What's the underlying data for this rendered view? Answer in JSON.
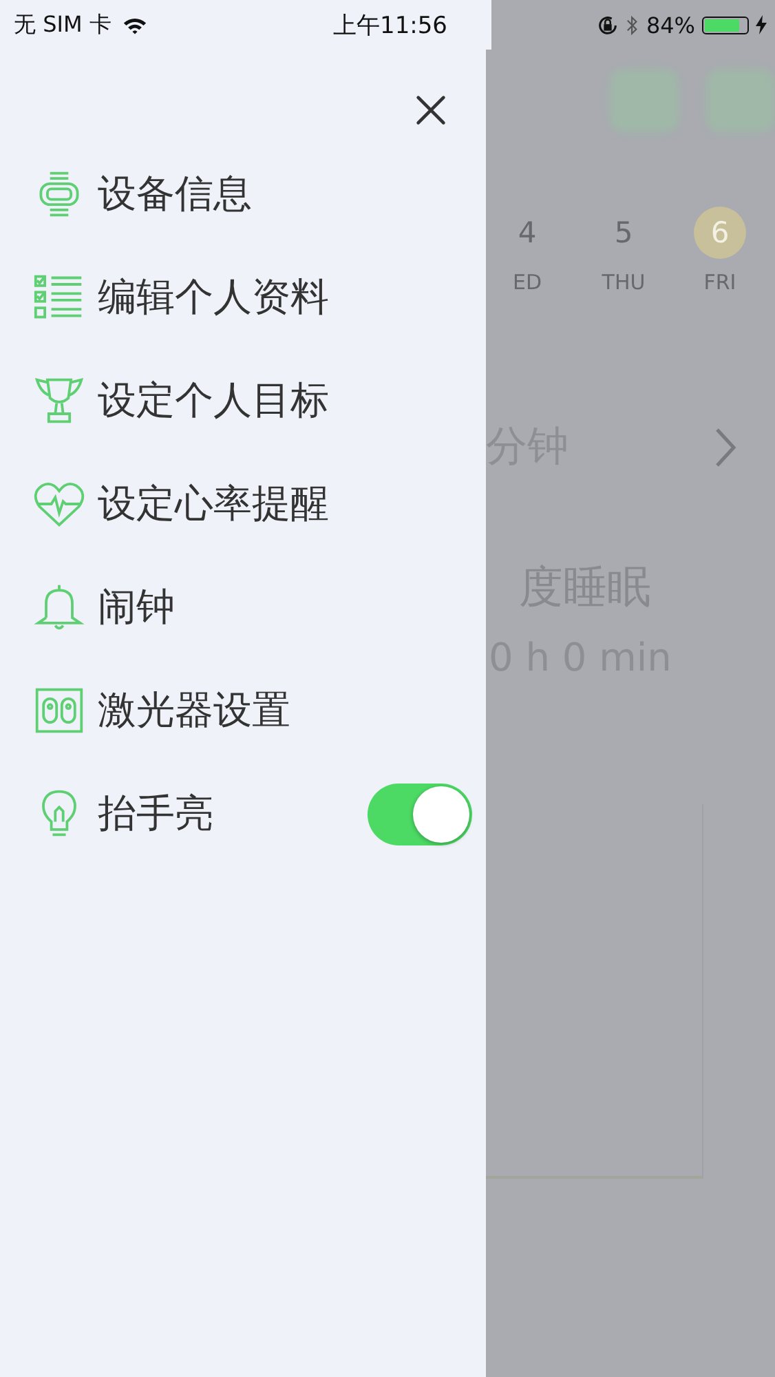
{
  "status_bar": {
    "carrier": "无 SIM 卡",
    "time": "上午11:56",
    "battery": "84%"
  },
  "drawer": {
    "items": [
      {
        "label": "设备信息",
        "kind": "link"
      },
      {
        "label": "编辑个人资料",
        "kind": "link"
      },
      {
        "label": "设定个人目标",
        "kind": "link"
      },
      {
        "label": "设定心率提醒",
        "kind": "link"
      },
      {
        "label": "闹钟",
        "kind": "link"
      },
      {
        "label": "激光器设置",
        "kind": "link"
      },
      {
        "label": "抬手亮",
        "kind": "toggle",
        "on": true
      }
    ]
  },
  "background": {
    "days": [
      {
        "number": "4",
        "label": "ED",
        "selected": false
      },
      {
        "number": "5",
        "label": "THU",
        "selected": false
      },
      {
        "number": "6",
        "label": "FRI",
        "selected": true
      }
    ],
    "duration_unit": "分钟",
    "sleep_title": "度睡眠",
    "sleep_value": "0 h 0 min"
  }
}
